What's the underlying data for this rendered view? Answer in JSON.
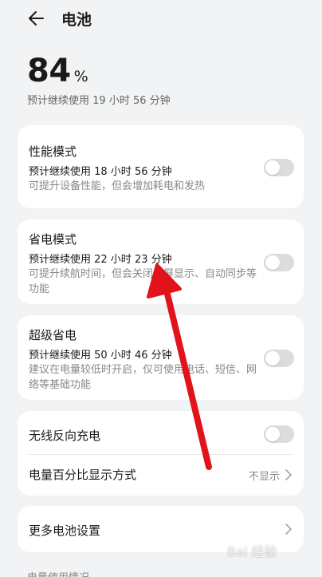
{
  "header": {
    "title": "电池"
  },
  "battery": {
    "percent": "84",
    "unit": "%",
    "estimate": "预计继续使用 19 小时 56 分钟"
  },
  "modes": [
    {
      "title": "性能模式",
      "sub": "预计继续使用 18 小时 56 分钟",
      "desc": "可提升设备性能，但会增加耗电和发热",
      "enabled": false
    },
    {
      "title": "省电模式",
      "sub": "预计继续使用 22 小时 23 分钟",
      "desc": "可提升续航时间，但会关闭熄屏显示、自动同步等功能",
      "enabled": false
    },
    {
      "title": "超级省电",
      "sub": "预计继续使用 50 小时 46 分钟",
      "desc": "建议在电量较低时开启，仅可使用电话、短信、网络等基础功能",
      "enabled": false
    }
  ],
  "settings": {
    "wireless": {
      "label": "无线反向充电",
      "enabled": false
    },
    "percent_display": {
      "label": "电量百分比显示方式",
      "value": "不显示"
    },
    "more": {
      "label": "更多电池设置"
    }
  },
  "footer": {
    "label": "电量使用情况"
  },
  "watermark": "Bai 经验",
  "colors": {
    "background": "#f1f3f5",
    "card": "#ffffff",
    "toggle_off": "#dcdcdc",
    "annotation_arrow": "#e0141a"
  },
  "icons": {
    "back": "back-arrow-icon",
    "chevron": "chevron-right-icon"
  }
}
